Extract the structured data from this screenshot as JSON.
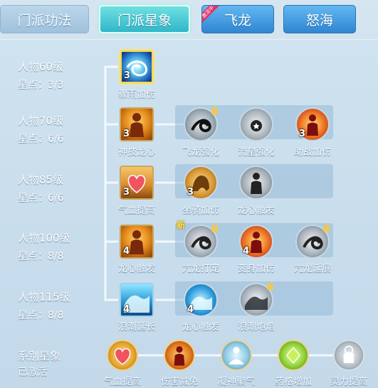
{
  "tabs": [
    {
      "label": "门派功法",
      "state": "inactive"
    },
    {
      "label": "门派星象",
      "state": "active"
    },
    {
      "label": "飞龙",
      "state": "special",
      "badge": "激活中"
    },
    {
      "label": "怒海",
      "state": "inactive"
    }
  ],
  "levels": [
    {
      "title": "人物60级",
      "points": "星点：3/3"
    },
    {
      "title": "人物70级",
      "points": "星点：6/6"
    },
    {
      "title": "人物85级",
      "points": "星点：6/6"
    },
    {
      "title": "人物100级",
      "points": "星点：8/8"
    },
    {
      "title": "人物115级",
      "points": "星点：8/8"
    }
  ],
  "skills": {
    "r1": [
      {
        "name": "骤雨加伤",
        "count": "3"
      }
    ],
    "r2": [
      {
        "name": "神技龙心",
        "count": "3"
      },
      {
        "name": "飞龙强化",
        "count": ""
      },
      {
        "name": "流星强化",
        "count": ""
      },
      {
        "name": "助战加伤",
        "count": "3"
      }
    ],
    "r3": [
      {
        "name": "气血提高",
        "count": "3"
      },
      {
        "name": "坐骑加伤",
        "count": "3"
      },
      {
        "name": "龙心触发",
        "count": ""
      }
    ],
    "r4": [
      {
        "name": "龙心触发",
        "count": "4"
      },
      {
        "name": "亢龙打宠",
        "count": ""
      },
      {
        "name": "变身加伤",
        "count": "4"
      },
      {
        "name": "亢龙延展",
        "count": ""
      }
    ],
    "r5": [
      {
        "name": "浪潮延长",
        "count": "4"
      },
      {
        "name": "龙心触发",
        "count": "4"
      },
      {
        "name": "浪潮炮焰",
        "count": ""
      }
    ]
  },
  "new_badge": "新",
  "series": {
    "title": "系别星象",
    "status": "已激活",
    "items": [
      "气血提高",
      "伤害减免",
      "凝神聚气",
      "药格增加",
      "灵力提高"
    ]
  },
  "colors": {
    "accent": "#2fb7c9",
    "gold": "#e3a22a",
    "special_tab": "#2f86d2",
    "badge": "#e0336a"
  }
}
